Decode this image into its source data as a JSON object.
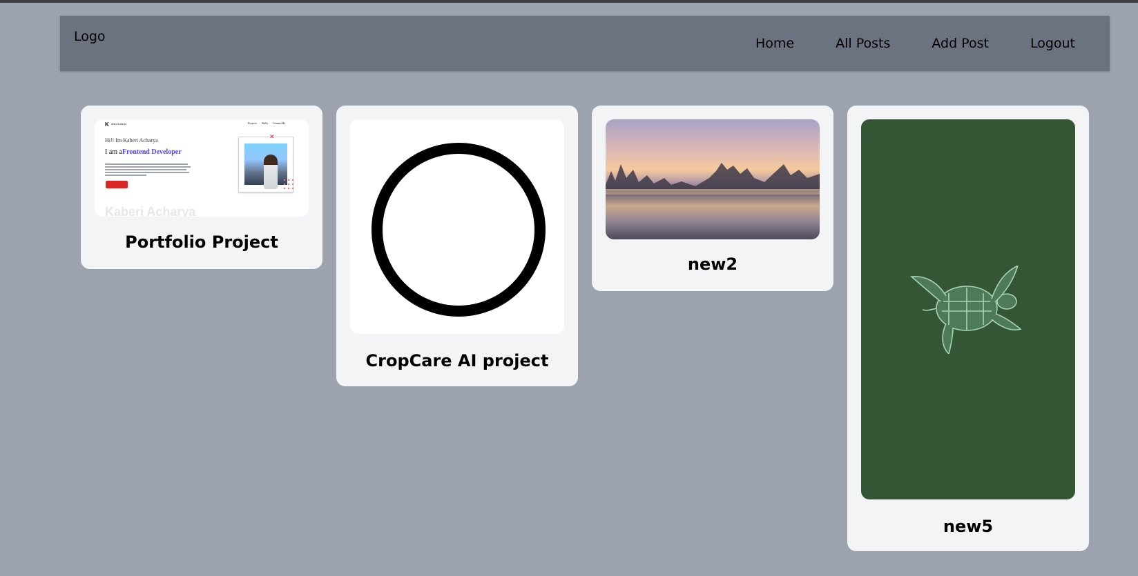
{
  "header": {
    "logo": "Logo",
    "nav": [
      {
        "label": "Home"
      },
      {
        "label": "All Posts"
      },
      {
        "label": "Add Post"
      },
      {
        "label": "Logout"
      }
    ]
  },
  "posts": [
    {
      "title": "Portfolio Project",
      "thumbnail": {
        "brand_letter": "K",
        "brand_name": "aberi Acharya",
        "nav_links": "Projects Skills ContactMe",
        "greeting": "Hi!! Im Kaberi Acharya",
        "headline_prefix": "I am a",
        "headline_role": "Frontend Developer",
        "ghost_text": "Kaberi Acharya"
      }
    },
    {
      "title": "CropCare AI project"
    },
    {
      "title": "new2"
    },
    {
      "title": "new5"
    }
  ],
  "colors": {
    "page_bg": "#9ca3af",
    "header_bg": "#6b7280",
    "card_bg": "#f3f4f6",
    "turtle_bg": "#345634"
  }
}
